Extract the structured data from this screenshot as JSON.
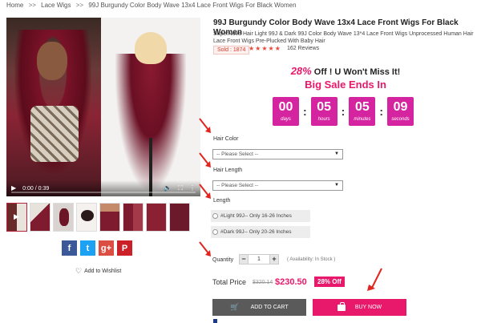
{
  "breadcrumb": {
    "items": [
      "Home",
      "Lace Wigs",
      "99J Burgundy Color Body Wave 13x4 Lace Front Wigs For Black Women"
    ],
    "separator": ">>"
  },
  "video": {
    "time": "0:00 / 0:39",
    "icons": [
      "play-icon",
      "volume-icon",
      "fullscreen-icon",
      "more-icon"
    ]
  },
  "product": {
    "title": "99J Burgundy Color Body Wave 13x4 Lace Front Wigs For Black Women",
    "subtitle": "SuperNova Hair Light 99J & Dark 99J Color Body Wave 13*4 Lace Front Wigs Unprocessed Human Hair Lace Front Wigs Pre-Plucked With Baby Hair",
    "sold": "Sold : 1874",
    "stars": "★★★★★",
    "reviews": "162 Reviews"
  },
  "promo": {
    "percent": "28%",
    "rest": " Off ! U Won't Miss It!",
    "big_sale": "Big Sale Ends In"
  },
  "countdown": [
    {
      "value": "00",
      "label": "days"
    },
    {
      "value": "05",
      "label": "hours"
    },
    {
      "value": "05",
      "label": "minutes"
    },
    {
      "value": "09",
      "label": "seconds"
    }
  ],
  "options": {
    "hair_color_label": "Hair Color",
    "hair_color_value": "-- Please Select --",
    "hair_length_label": "Hair Length",
    "hair_length_value": "-- Please Select --",
    "length_label": "Length",
    "length_options": [
      "#Light 99J-- Only 16-26 Inches",
      "#Dark 99J-- Only 20-26 Inches"
    ]
  },
  "quantity": {
    "label": "Quantity",
    "minus": "−",
    "value": "1",
    "plus": "+",
    "availability": "( Availability: In Stock )"
  },
  "total": {
    "label": "Total Price",
    "old_price": "$320.14",
    "new_price": "$230.50",
    "off_badge": "28% Off"
  },
  "buttons": {
    "add_to_cart": "ADD TO CART",
    "buy_now": "BUY NOW"
  },
  "share": {
    "facebook": "f",
    "twitter": "t",
    "googleplus": "g+",
    "pinterest": "P"
  },
  "wishlist": "Add to Wishlist",
  "colors": {
    "accent_pink": "#e8186a",
    "countdown_magenta": "#d5249f",
    "annotation_red": "#e0261f"
  }
}
